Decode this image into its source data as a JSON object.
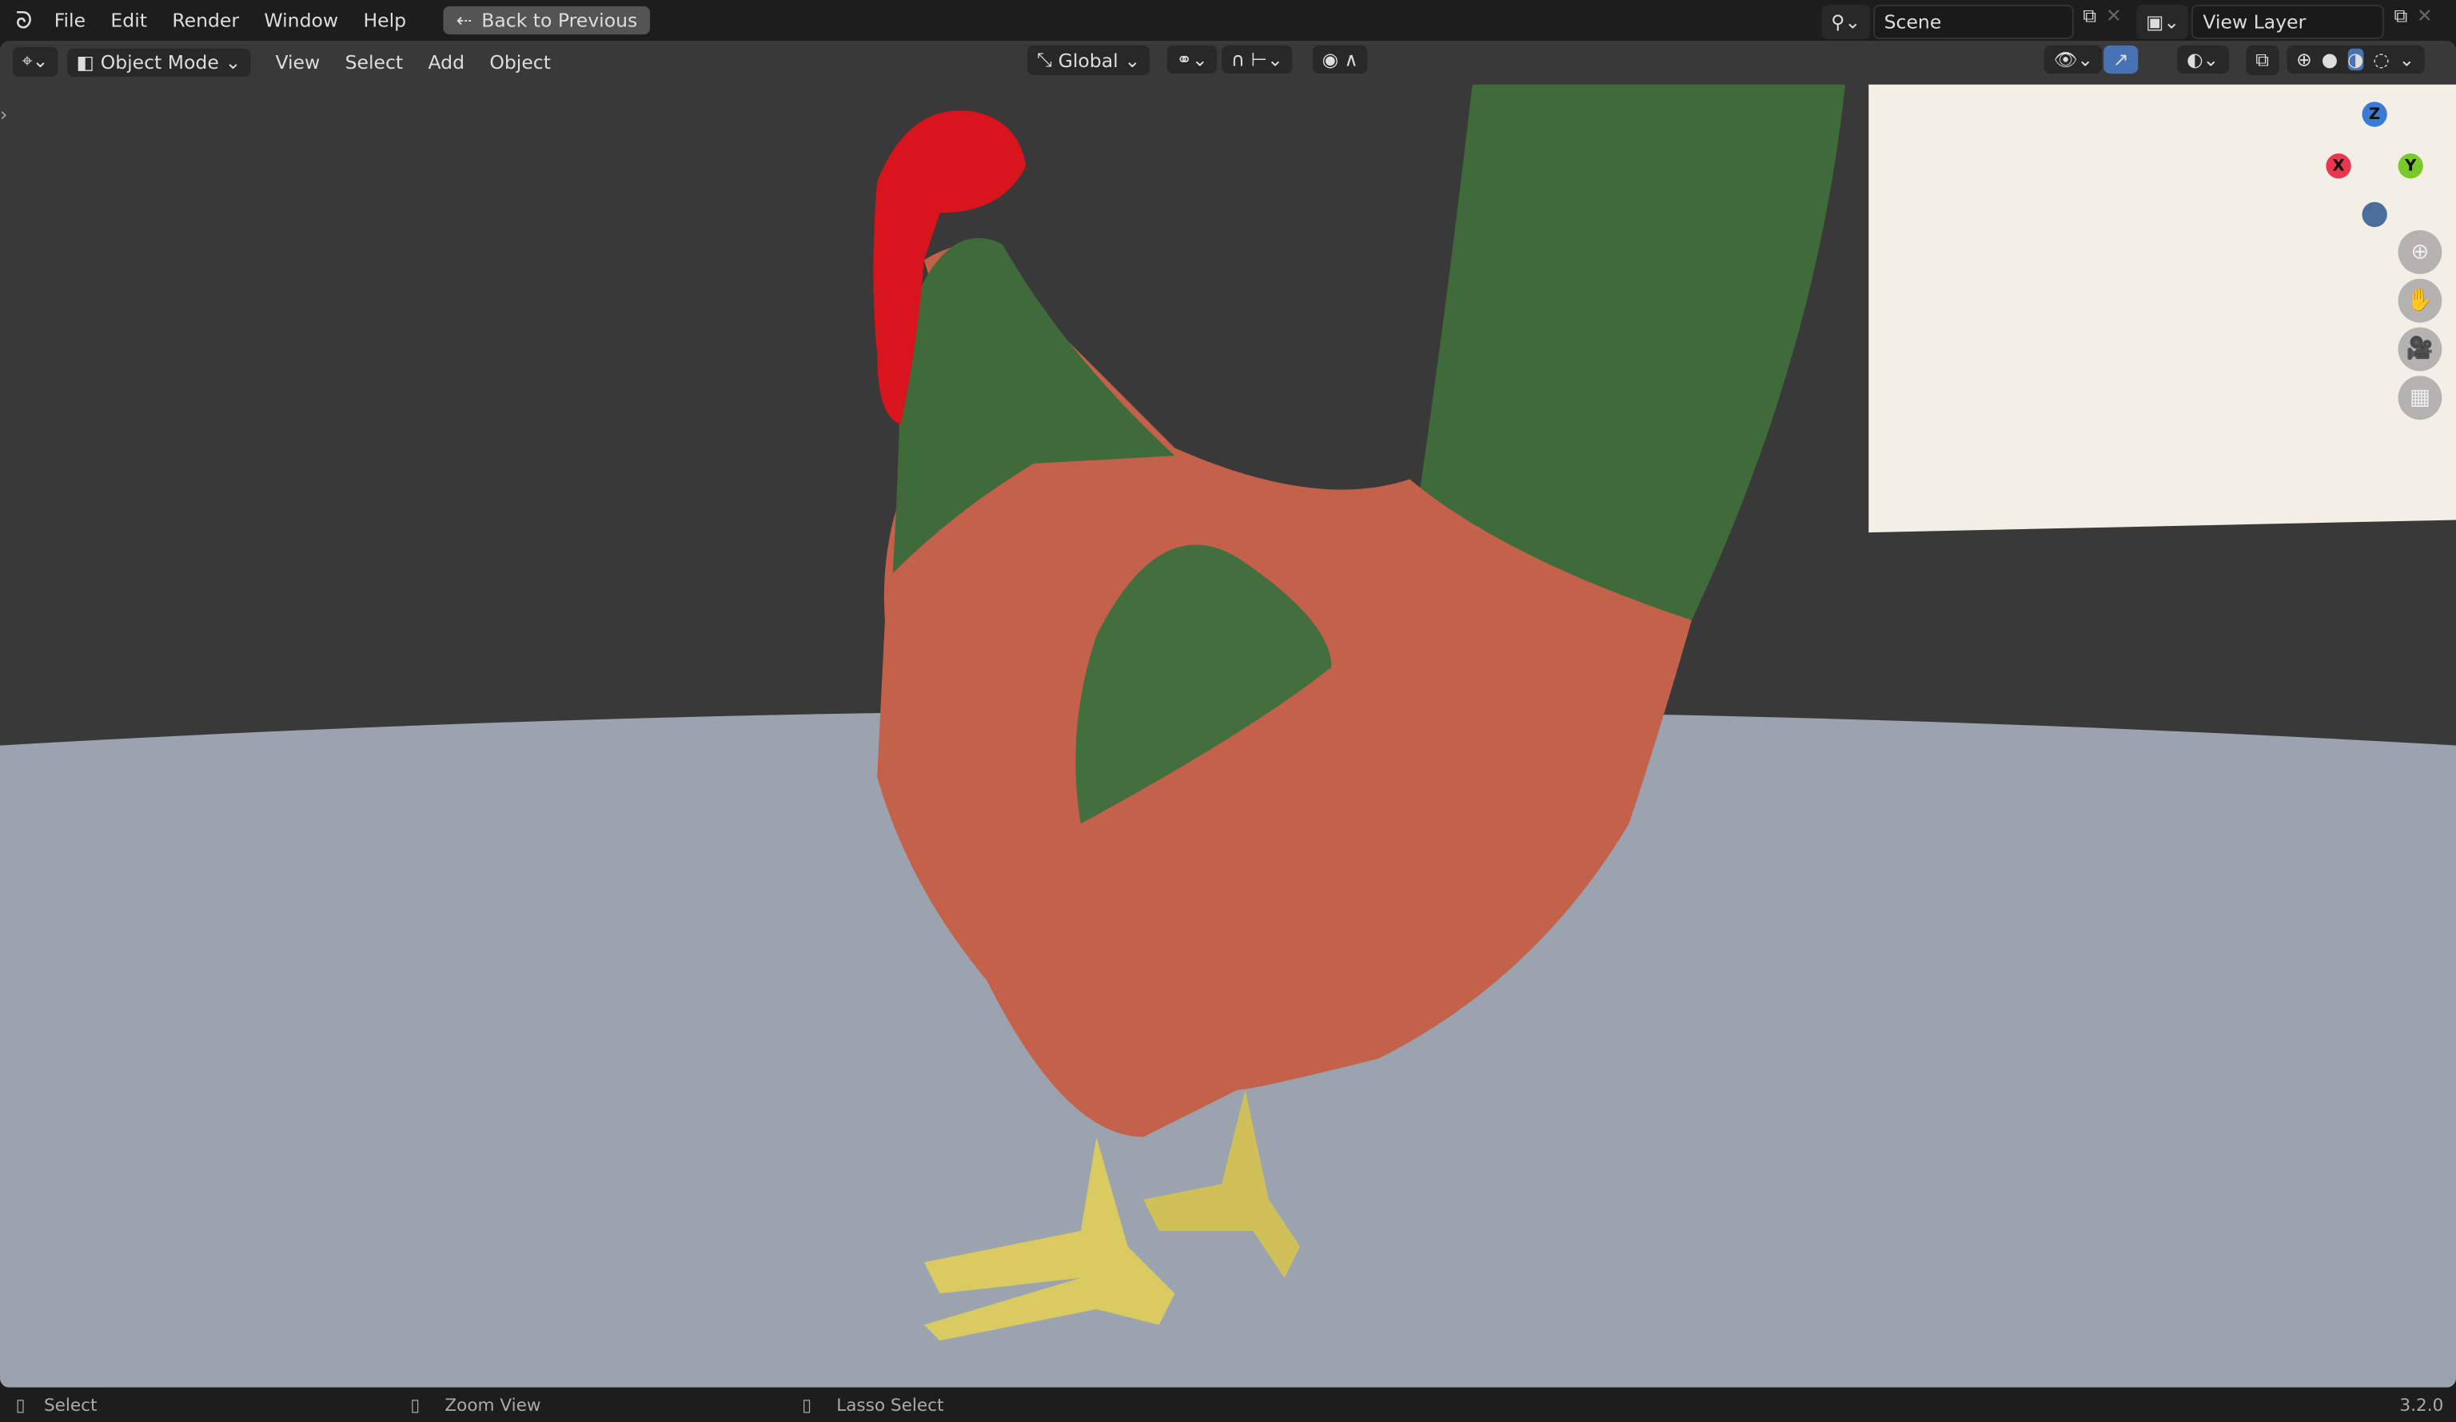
{
  "topbar": {
    "menus": [
      "File",
      "Edit",
      "Render",
      "Window",
      "Help"
    ],
    "back_button": "Back to Previous",
    "scene": "Scene",
    "view_layer": "View Layer"
  },
  "header": {
    "mode": "Object Mode",
    "menus": [
      "View",
      "Select",
      "Add",
      "Object"
    ],
    "orientation": "Global"
  },
  "gizmo": {
    "x": "X",
    "y": "Y",
    "z": "Z"
  },
  "status": {
    "items": [
      "Select",
      "Zoom View",
      "Lasso Select"
    ],
    "version": "3.2.0"
  },
  "colors": {
    "accent": "#4772b3",
    "floor": "#9aa2ae",
    "body": "#c4614b",
    "feathers": "#3f6a3a",
    "comb": "#d8141c",
    "legs": "#d9cb62"
  }
}
